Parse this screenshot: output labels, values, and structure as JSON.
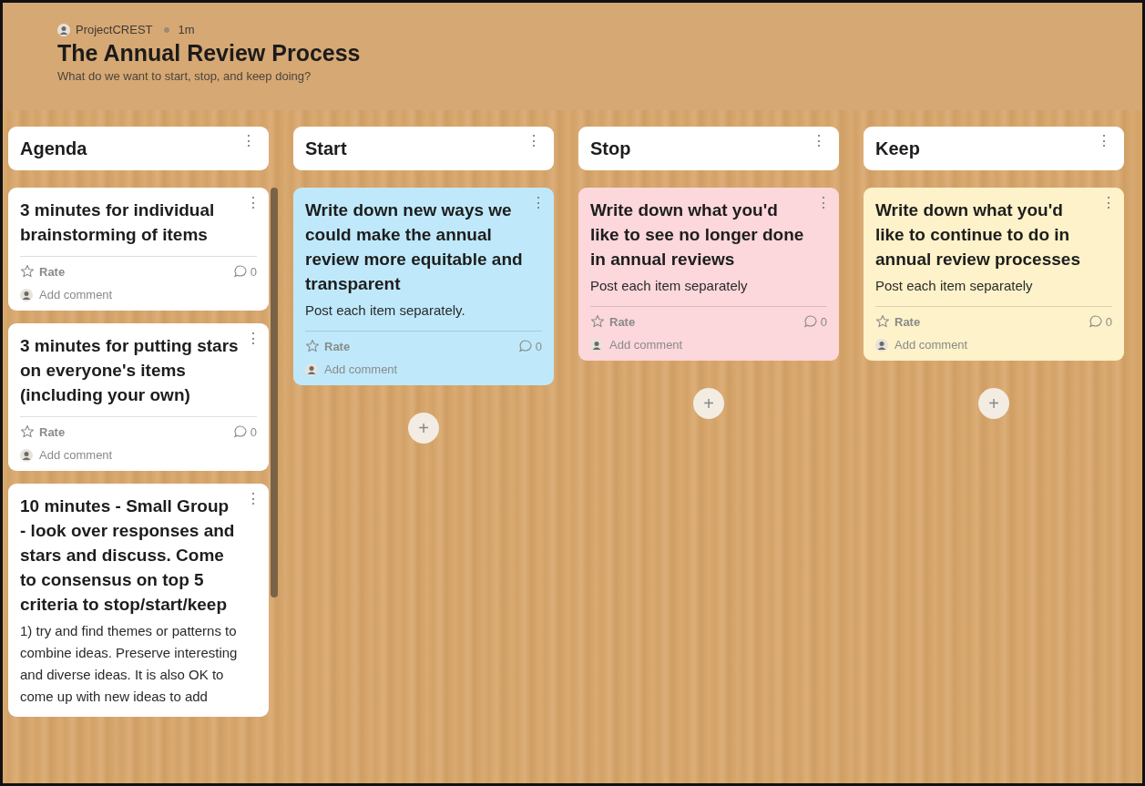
{
  "header": {
    "author": "ProjectCREST",
    "time": "1m",
    "title": "The Annual Review Process",
    "subtitle": "What do we want to start, stop, and keep doing?"
  },
  "columns": [
    {
      "title": "Agenda",
      "menu": "⋮",
      "cards": [
        {
          "title": "3 minutes for individual brainstorming of items",
          "color": "#ffffff",
          "menu": "⋮",
          "footer": {
            "rate": "Rate",
            "comments": "0",
            "add_comment": "Add comment"
          }
        },
        {
          "title": "3 minutes for putting stars on everyone's items (including your own)",
          "color": "#ffffff",
          "menu": "⋮",
          "footer": {
            "rate": "Rate",
            "comments": "0",
            "add_comment": "Add comment"
          }
        },
        {
          "title": "10 minutes - Small Group - look over responses and stars and discuss. Come to consensus on top 5 criteria to stop/start/keep",
          "body": "1) try and find themes or patterns to combine ideas. Preserve interesting and diverse ideas. It is also OK to come up with new ideas to add",
          "color": "#ffffff",
          "menu": "⋮"
        }
      ]
    },
    {
      "title": "Start",
      "menu": "⋮",
      "add": "+",
      "cards": [
        {
          "title": "Write down new ways we could make the annual review more equitable and transparent",
          "body": "Post each item separately.",
          "color": "#bfe9fb",
          "menu": "⋮",
          "footer": {
            "rate": "Rate",
            "comments": "0",
            "add_comment": "Add comment"
          }
        }
      ]
    },
    {
      "title": "Stop",
      "menu": "⋮",
      "add": "+",
      "cards": [
        {
          "title": "Write down what you'd like to see no longer done in annual reviews",
          "body": "Post each item separately",
          "color": "#fcd7dc",
          "menu": "⋮",
          "footer": {
            "rate": "Rate",
            "comments": "0",
            "add_comment": "Add comment"
          }
        }
      ]
    },
    {
      "title": "Keep",
      "menu": "⋮",
      "add": "+",
      "cards": [
        {
          "title": "Write down what you'd like to continue to do in annual review processes",
          "body": "Post each item separately",
          "color": "#fdf2c9",
          "menu": "⋮",
          "footer": {
            "rate": "Rate",
            "comments": "0",
            "add_comment": "Add comment"
          }
        }
      ]
    }
  ]
}
